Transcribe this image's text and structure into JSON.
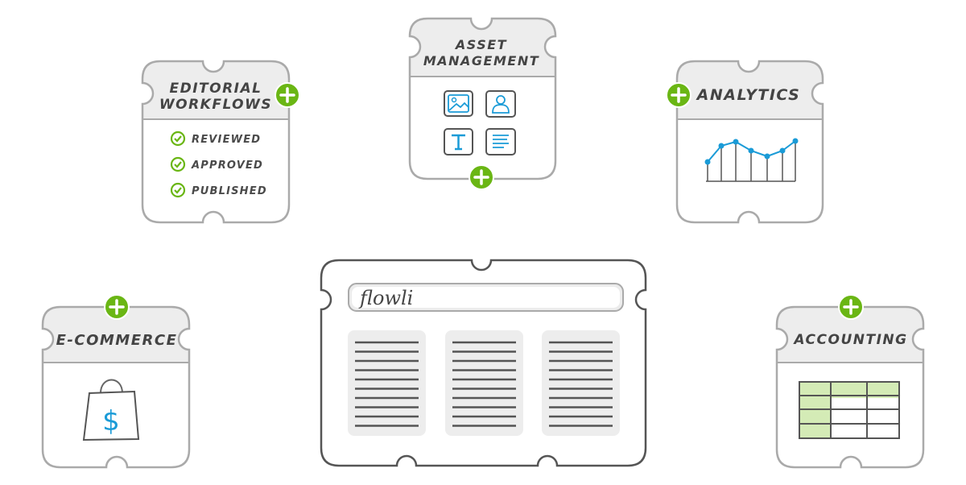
{
  "colors": {
    "accent_green": "#6ab614",
    "icon_blue": "#1a9bd7",
    "header_gray": "#ededed",
    "border_gray": "#aaaaaa",
    "border_dark": "#555555",
    "table_green": "#d4ebb6"
  },
  "modules": {
    "editorial": {
      "title_line1": "EDITORIAL",
      "title_line2": "WORKFLOWS",
      "items": [
        "REVIEWED",
        "APPROVED",
        "PUBLISHED"
      ],
      "item_icon": "check-circle-icon"
    },
    "asset": {
      "title_line1": "ASSET",
      "title_line2": "MANAGEMENT",
      "icons": [
        "image-icon",
        "person-icon",
        "text-icon",
        "document-icon"
      ]
    },
    "analytics": {
      "title": "ANALYTICS",
      "icon": "line-chart-icon"
    },
    "ecommerce": {
      "title": "E-COMMERCE",
      "icon": "shopping-bag-dollar-icon",
      "bag_symbol": "$"
    },
    "accounting": {
      "title": "ACCOUNTING",
      "icon": "spreadsheet-icon"
    }
  },
  "core": {
    "search_text": "flowli",
    "columns": 3
  }
}
